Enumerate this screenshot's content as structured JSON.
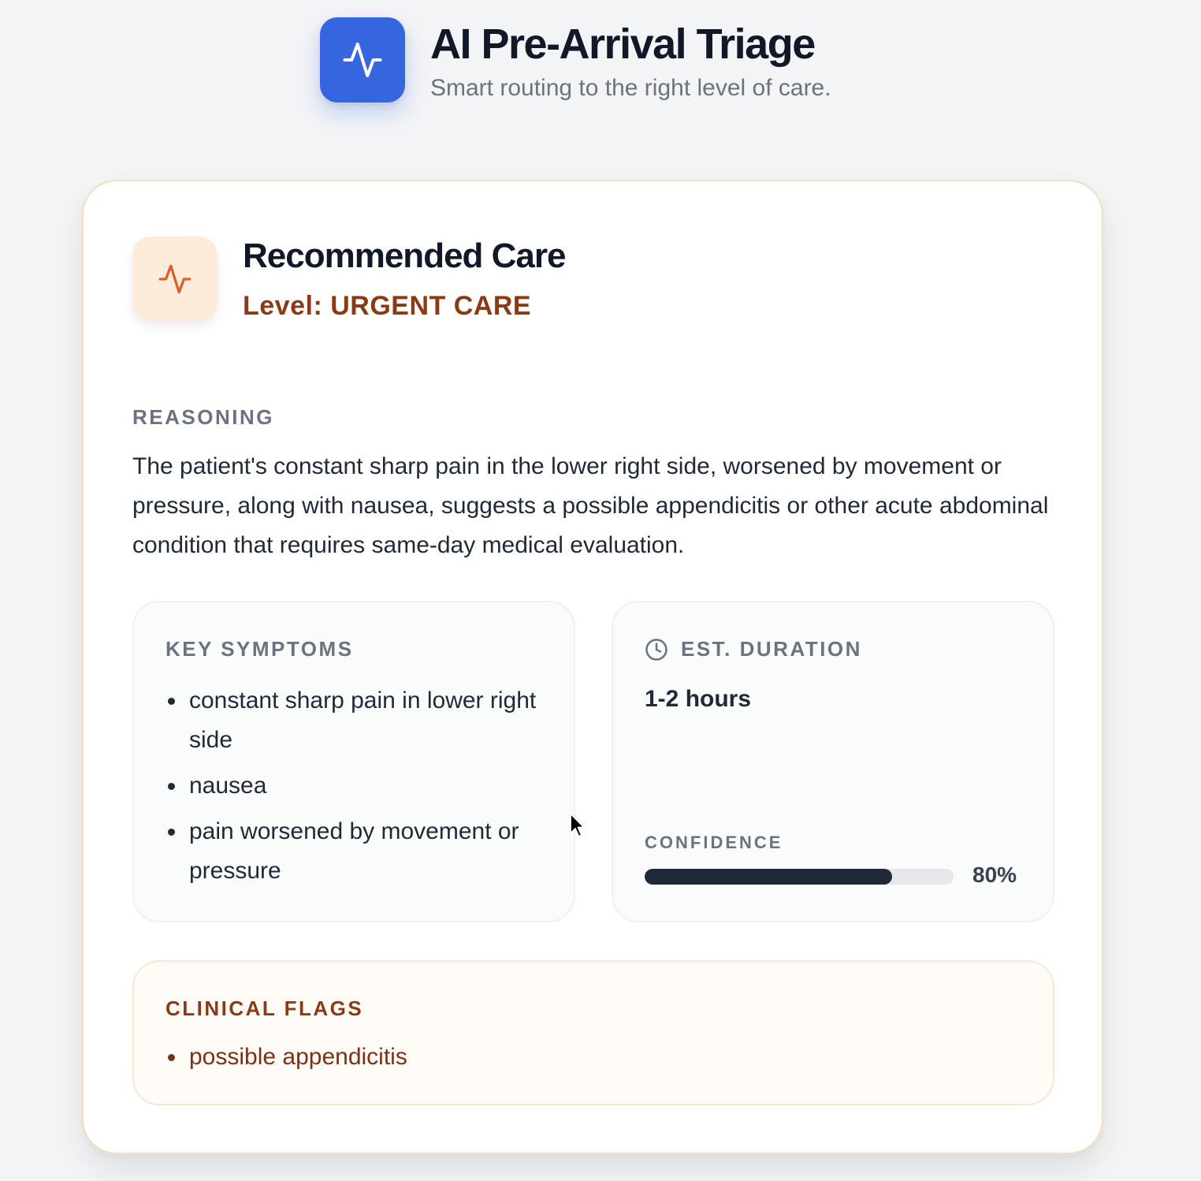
{
  "header": {
    "title": "AI Pre-Arrival Triage",
    "subtitle": "Smart routing to the right level of care.",
    "logo_icon": "activity-pulse-icon",
    "logo_color": "#3566e0"
  },
  "recommendation": {
    "title": "Recommended Care",
    "level_text": "Level: URGENT CARE",
    "icon": "activity-pulse-icon",
    "accent_color": "#8a3b15",
    "icon_bg": "#fdecdc"
  },
  "reasoning": {
    "label": "REASONING",
    "text": "The patient's constant sharp pain in the lower right side, worsened by movement or pressure, along with nausea, suggests a possible appendicitis or other acute abdominal condition that requires same-day medical evaluation."
  },
  "symptoms": {
    "label": "KEY SYMPTOMS",
    "items": [
      "constant sharp pain in lower right side",
      "nausea",
      "pain worsened by movement or pressure"
    ]
  },
  "duration": {
    "label": "EST. DURATION",
    "icon": "clock-icon",
    "value": "1-2 hours"
  },
  "confidence": {
    "label": "CONFIDENCE",
    "percent": 80,
    "display": "80%"
  },
  "flags": {
    "label": "CLINICAL FLAGS",
    "items": [
      "possible appendicitis"
    ]
  }
}
